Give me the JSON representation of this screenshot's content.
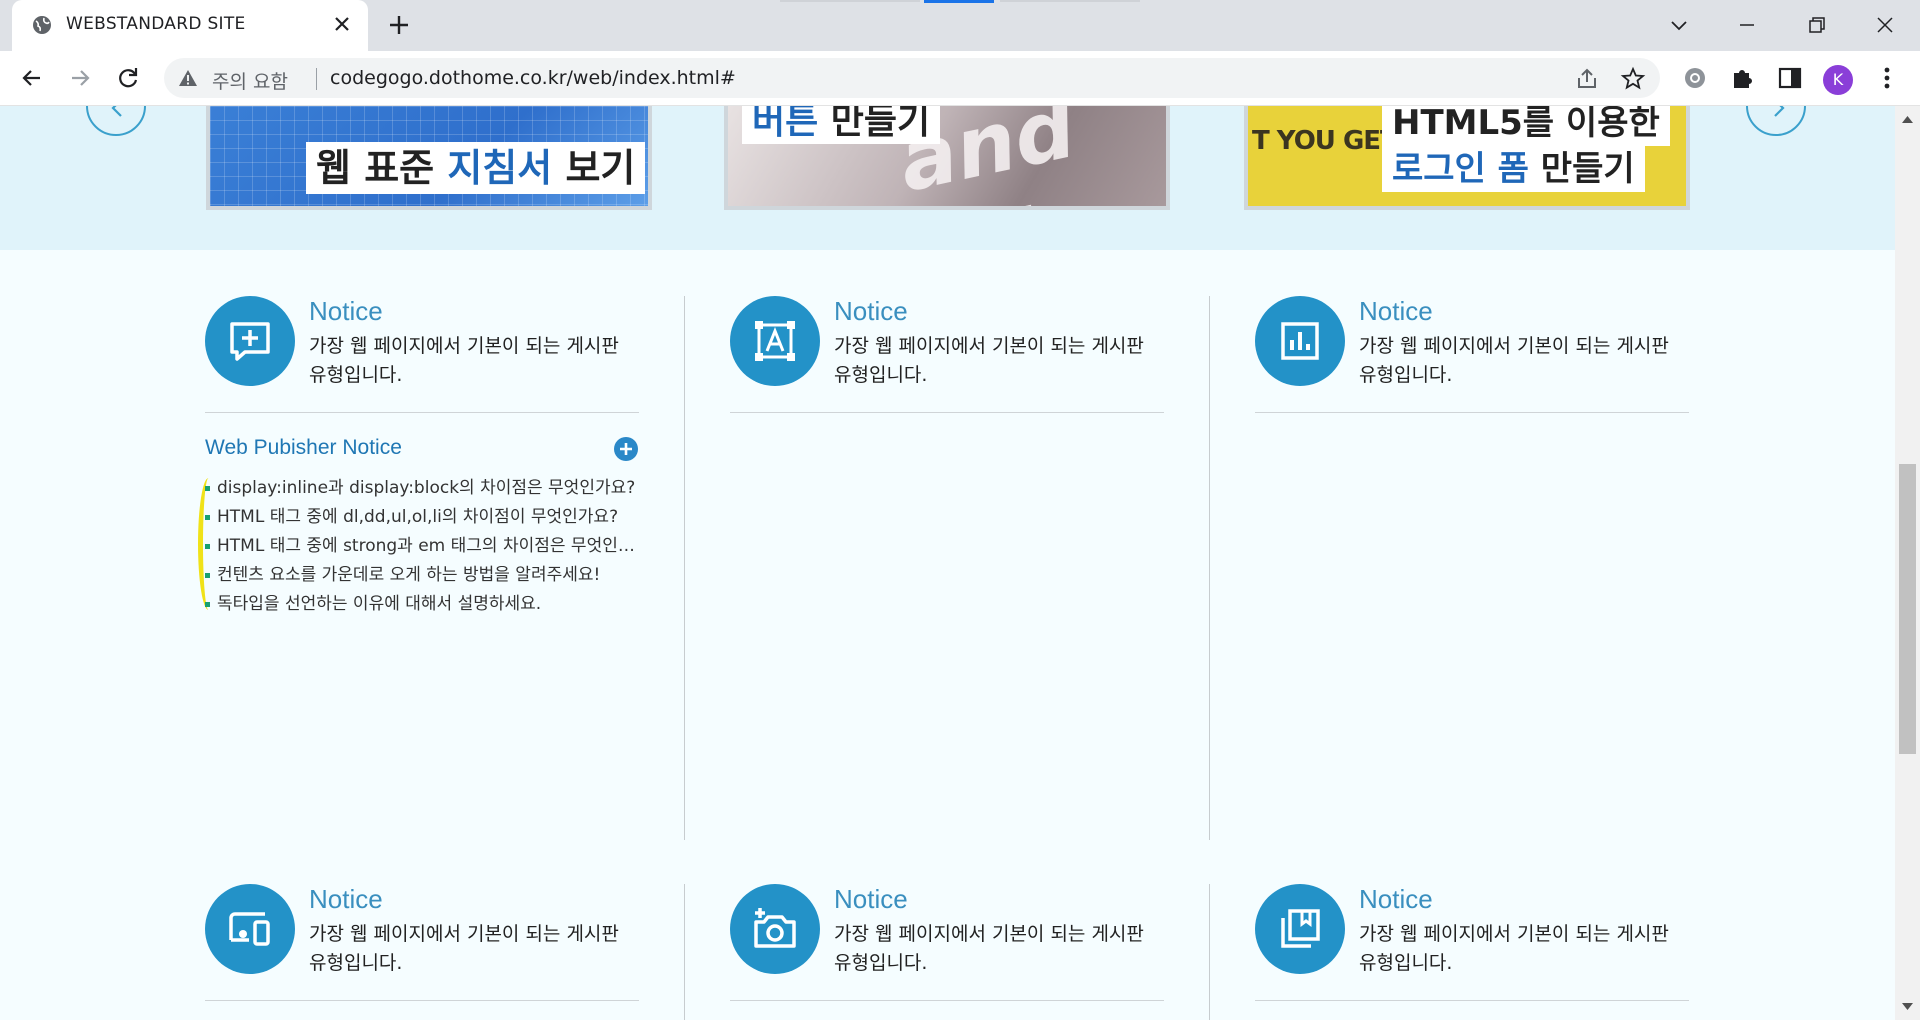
{
  "browser": {
    "tab_title": "WEBSTANDARD SITE",
    "security_warning": "주의 요함",
    "url": "codegogo.dothome.co.kr/web/index.html#",
    "avatar_letter": "K",
    "accent_color": "#1a73e8"
  },
  "slider": {
    "slides": [
      {
        "caption_parts": [
          "웹 표준 ",
          "지침서",
          " 보기"
        ]
      },
      {
        "caption_parts": [
          "버튼",
          " 만들기"
        ],
        "deco": "and inte"
      },
      {
        "caption_line1": "HTML5를 이용한",
        "caption_line2_parts": [
          "로그인 폼",
          " 만들기"
        ],
        "deco": "T YOU GET"
      }
    ]
  },
  "cards_row1": [
    {
      "icon": "add-comment-icon",
      "title": "Notice",
      "desc": "가장 웹 페이지에서 기본이 되는 게시판 유형입니다."
    },
    {
      "icon": "text-frame-icon",
      "title": "Notice",
      "desc": "가장 웹 페이지에서 기본이 되는 게시판 유형입니다."
    },
    {
      "icon": "bar-chart-icon",
      "title": "Notice",
      "desc": "가장 웹 페이지에서 기본이 되는 게시판 유형입니다."
    }
  ],
  "cards_row2": [
    {
      "icon": "devices-icon",
      "title": "Notice",
      "desc": "가장 웹 페이지에서 기본이 되는 게시판 유형입니다."
    },
    {
      "icon": "add-photo-icon",
      "title": "Notice",
      "desc": "가장 웹 페이지에서 기본이 되는 게시판 유형입니다."
    },
    {
      "icon": "library-icon",
      "title": "Notice",
      "desc": "가장 웹 페이지에서 기본이 되는 게시판 유형입니다."
    }
  ],
  "notice": {
    "heading": "Web Pubisher Notice",
    "items": [
      "display:inline과 display:block의 차이점은 무엇인가요?",
      "HTML 태그 중에 dl,dd,ul,ol,li의 차이점이 무엇인가요?",
      "HTML 태그 중에 strong과 em 태그의 차이점은 무엇인가요?",
      "컨텐츠 요소를 가운데로 오게 하는 방법을 알려주세요!",
      "독타입을 선언하는 이유에 대해서 설명하세요."
    ]
  },
  "colors": {
    "brand_blue": "#2392c8",
    "title_blue": "#3a8fbf",
    "band": "#e0f3fa",
    "bullet": "#18a070"
  }
}
